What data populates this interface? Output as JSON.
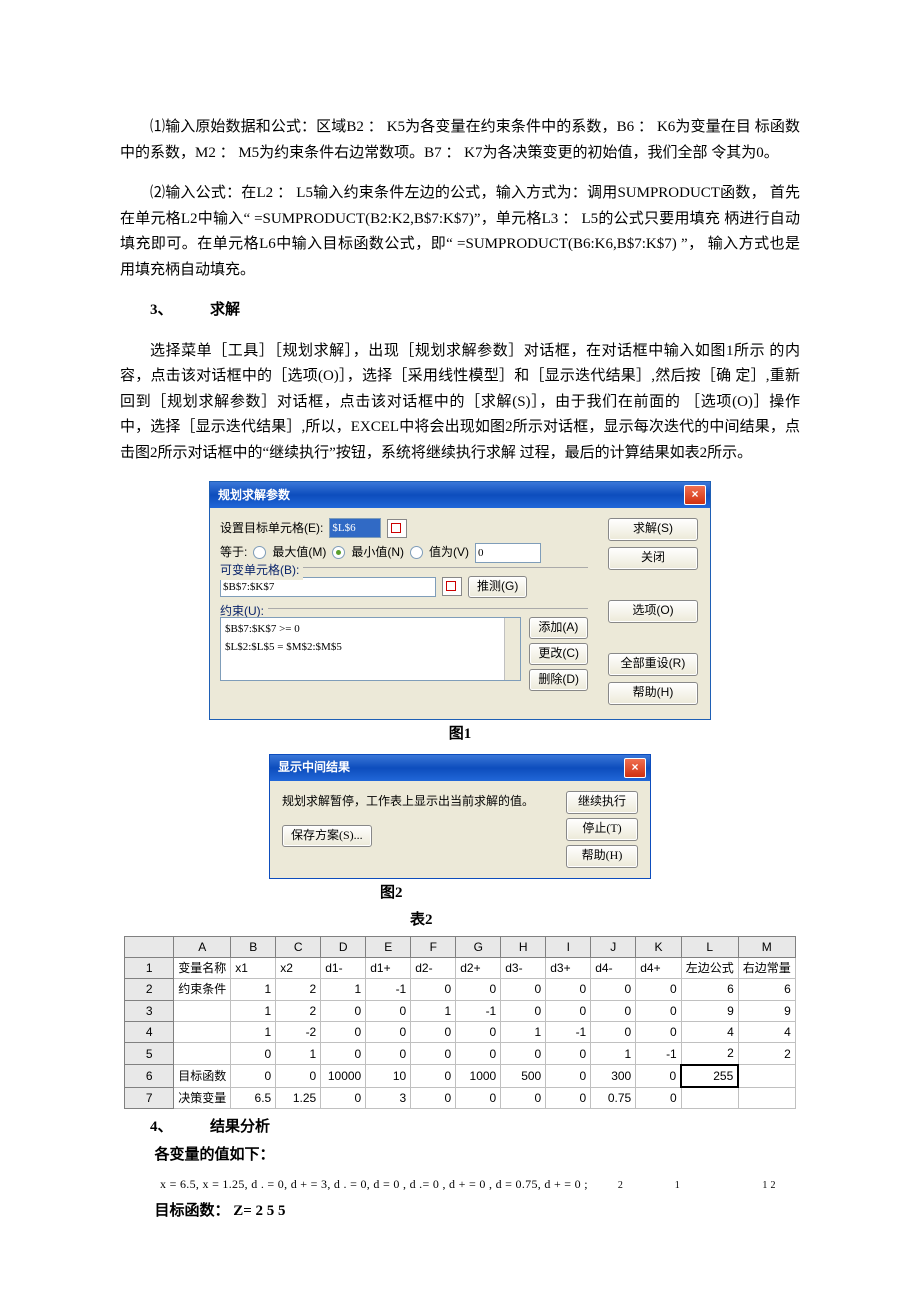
{
  "para1": "⑴输入原始数据和公式：区域B2 ： K5为各变量在约束条件中的系数，B6 ： K6为变量在目 标函数中的系数，M2 ： M5为约束条件右边常数项。B7 ： K7为各决策变更的初始值，我们全部 令其为0。",
  "para2": "⑵输入公式：在L2 ： L5输入约束条件左边的公式，输入方式为：调用SUMPRODUCT函数， 首先在单元格L2中输入“ =SUMPRODUCT(B2:K2,B$7:K$7)”，单元格L3 ： L5的公式只要用填充 柄进行自动填充即可。在单元格L6中输入目标函数公式，即“ =SUMPRODUCT(B6:K6,B$7:K$7) ”， 输入方式也是用填充柄自动填充。",
  "heading3": "3、　　　求解",
  "para3": "选择菜单［工具］［规划求解］，出现［规划求解参数］对话框，在对话框中输入如图1所示 的内容，点击该对话框中的［选项(O)］，选择［采用线性模型］和［显示迭代结果］,然后按［确 定］,重新回到［规划求解参数］对话框，点击该对话框中的［求解(S)］，由于我们在前面的 ［选项(O)］操作中，选择［显示迭代结果］,所以，EXCEL中将会出现如图2所示对话框，显示每次迭代的中间结果，点击图2所示对话框中的“继续执行”按钮，系统将继续执行求解 过程，最后的计算结果如表2所示。",
  "dlg1": {
    "title": "规划求解参数",
    "target_label": "设置目标单元格(E):",
    "target_val": "$L$6",
    "equal": "等于:",
    "max": "最大值(M)",
    "min": "最小值(N)",
    "val": "值为(V)",
    "val_input": "0",
    "changing": "可变单元格(B):",
    "changing_val": "$B$7:$K$7",
    "guess": "推测(G)",
    "constraints": "约束(U):",
    "c1": "$B$7:$K$7 >= 0",
    "c2": "$L$2:$L$5 = $M$2:$M$5",
    "add": "添加(A)",
    "change": "更改(C)",
    "delete": "删除(D)",
    "solve": "求解(S)",
    "close": "关闭",
    "options": "选项(O)",
    "reset": "全部重设(R)",
    "help": "帮助(H)"
  },
  "fig1": "图1",
  "dlg2": {
    "title": "显示中间结果",
    "msg": "规划求解暂停，工作表上显示出当前求解的值。",
    "save": "保存方案(S)...",
    "cont": "继续执行",
    "stop": "停止(T)",
    "help": "帮助(H)"
  },
  "fig2": "图2",
  "tbl2": "表2",
  "table": {
    "cols": [
      "",
      "A",
      "B",
      "C",
      "D",
      "E",
      "F",
      "G",
      "H",
      "I",
      "J",
      "K",
      "L",
      "M"
    ],
    "rows": [
      [
        "1",
        "变量名称",
        "x1",
        "x2",
        "d1-",
        "d1+",
        "d2-",
        "d2+",
        "d3-",
        "d3+",
        "d4-",
        "d4+",
        "左边公式",
        "右边常量"
      ],
      [
        "2",
        "约束条件",
        "1",
        "2",
        "1",
        "-1",
        "0",
        "0",
        "0",
        "0",
        "0",
        "0",
        "6",
        "6"
      ],
      [
        "3",
        "",
        "1",
        "2",
        "0",
        "0",
        "1",
        "-1",
        "0",
        "0",
        "0",
        "0",
        "9",
        "9"
      ],
      [
        "4",
        "",
        "1",
        "-2",
        "0",
        "0",
        "0",
        "0",
        "1",
        "-1",
        "0",
        "0",
        "4",
        "4"
      ],
      [
        "5",
        "",
        "0",
        "1",
        "0",
        "0",
        "0",
        "0",
        "0",
        "0",
        "1",
        "-1",
        "2",
        "2"
      ],
      [
        "6",
        "目标函数",
        "0",
        "0",
        "10000",
        "10",
        "0",
        "1000",
        "500",
        "0",
        "300",
        "0",
        "255",
        ""
      ],
      [
        "7",
        "决策变量",
        "6.5",
        "1.25",
        "0",
        "3",
        "0",
        "0",
        "0",
        "0",
        "0.75",
        "0",
        "",
        ""
      ]
    ]
  },
  "heading4": "4、　　　结果分析",
  "sub4": "各变量的值如下：",
  "eq": "x = 6.5, x = 1.25, d . = 0, d + = 3, d . = 0, d = 0 , d .= 0 , d + = 0 , d = 0.75, d + = 0 ;",
  "eqtail": "2　　　　　1　　　　　　　　1  2",
  "obj": "目标函数：  Z= 2 5 5"
}
